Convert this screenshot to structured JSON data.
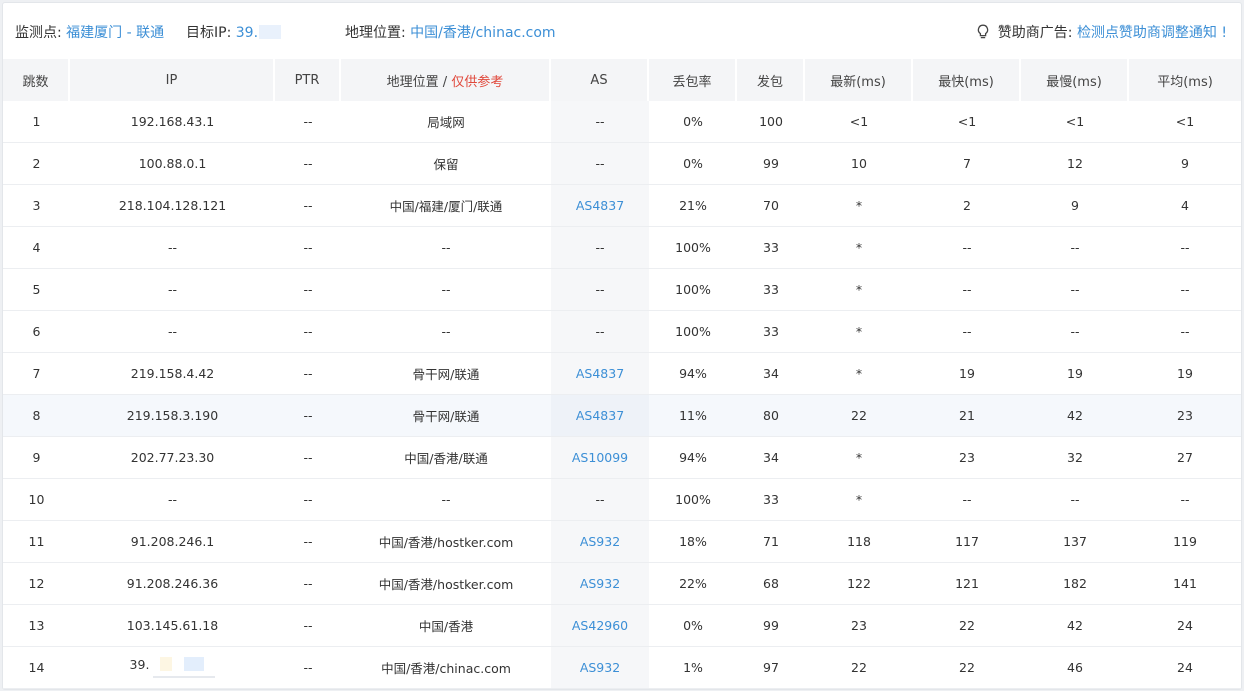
{
  "info": {
    "monitor_label": "监测点:",
    "monitor_value": "福建厦门 - 联通",
    "target_label": "目标IP:",
    "target_value": "39.",
    "geo_label": "地理位置:",
    "geo_value": "中国/香港/chinac.com",
    "sponsor_label": "赞助商广告:",
    "sponsor_link": "检测点赞助商调整通知 !"
  },
  "columns": {
    "hop": "跳数",
    "ip": "IP",
    "ptr": "PTR",
    "geo": "地理位置 / ",
    "geo_ref": "仅供参考",
    "as": "AS",
    "loss": "丢包率",
    "sent": "发包",
    "last": "最新(ms)",
    "best": "最快(ms)",
    "worst": "最慢(ms)",
    "avg": "平均(ms)"
  },
  "rows": [
    {
      "hop": "1",
      "ip": "192.168.43.1",
      "ptr": "--",
      "geo": "局域网",
      "as": "--",
      "loss": "0%",
      "sent": "100",
      "last": "<1",
      "best": "<1",
      "worst": "<1",
      "avg": "<1"
    },
    {
      "hop": "2",
      "ip": "100.88.0.1",
      "ptr": "--",
      "geo": "保留",
      "as": "--",
      "loss": "0%",
      "sent": "99",
      "last": "10",
      "best": "7",
      "worst": "12",
      "avg": "9"
    },
    {
      "hop": "3",
      "ip": "218.104.128.121",
      "ptr": "--",
      "geo": "中国/福建/厦门/联通",
      "as": "AS4837",
      "loss": "21%",
      "sent": "70",
      "last": "*",
      "best": "2",
      "worst": "9",
      "avg": "4"
    },
    {
      "hop": "4",
      "ip": "--",
      "ptr": "--",
      "geo": "--",
      "as": "--",
      "loss": "100%",
      "sent": "33",
      "last": "*",
      "best": "--",
      "worst": "--",
      "avg": "--"
    },
    {
      "hop": "5",
      "ip": "--",
      "ptr": "--",
      "geo": "--",
      "as": "--",
      "loss": "100%",
      "sent": "33",
      "last": "*",
      "best": "--",
      "worst": "--",
      "avg": "--"
    },
    {
      "hop": "6",
      "ip": "--",
      "ptr": "--",
      "geo": "--",
      "as": "--",
      "loss": "100%",
      "sent": "33",
      "last": "*",
      "best": "--",
      "worst": "--",
      "avg": "--"
    },
    {
      "hop": "7",
      "ip": "219.158.4.42",
      "ptr": "--",
      "geo": "骨干网/联通",
      "as": "AS4837",
      "loss": "94%",
      "sent": "34",
      "last": "*",
      "best": "19",
      "worst": "19",
      "avg": "19"
    },
    {
      "hop": "8",
      "ip": "219.158.3.190",
      "ptr": "--",
      "geo": "骨干网/联通",
      "as": "AS4837",
      "loss": "11%",
      "sent": "80",
      "last": "22",
      "best": "21",
      "worst": "42",
      "avg": "23"
    },
    {
      "hop": "9",
      "ip": "202.77.23.30",
      "ptr": "--",
      "geo": "中国/香港/联通",
      "as": "AS10099",
      "loss": "94%",
      "sent": "34",
      "last": "*",
      "best": "23",
      "worst": "32",
      "avg": "27"
    },
    {
      "hop": "10",
      "ip": "--",
      "ptr": "--",
      "geo": "--",
      "as": "--",
      "loss": "100%",
      "sent": "33",
      "last": "*",
      "best": "--",
      "worst": "--",
      "avg": "--"
    },
    {
      "hop": "11",
      "ip": "91.208.246.1",
      "ptr": "--",
      "geo": "中国/香港/hostker.com",
      "as": "AS932",
      "loss": "18%",
      "sent": "71",
      "last": "118",
      "best": "117",
      "worst": "137",
      "avg": "119"
    },
    {
      "hop": "12",
      "ip": "91.208.246.36",
      "ptr": "--",
      "geo": "中国/香港/hostker.com",
      "as": "AS932",
      "loss": "22%",
      "sent": "68",
      "last": "122",
      "best": "121",
      "worst": "182",
      "avg": "141"
    },
    {
      "hop": "13",
      "ip": "103.145.61.18",
      "ptr": "--",
      "geo": "中国/香港",
      "as": "AS42960",
      "loss": "0%",
      "sent": "99",
      "last": "23",
      "best": "22",
      "worst": "42",
      "avg": "24"
    },
    {
      "hop": "14",
      "ip": "39.",
      "ptr": "--",
      "geo": "中国/香港/chinac.com",
      "as": "AS932",
      "loss": "1%",
      "sent": "97",
      "last": "22",
      "best": "22",
      "worst": "46",
      "avg": "24"
    }
  ],
  "highlight_row": "8"
}
